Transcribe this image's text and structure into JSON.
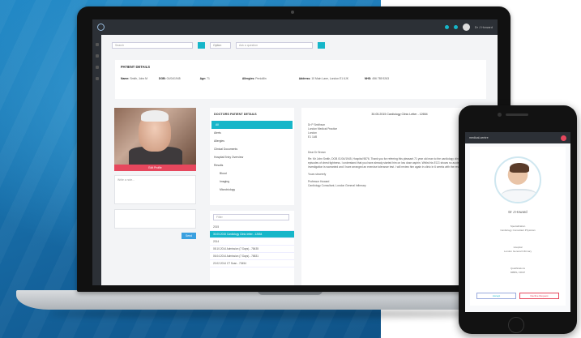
{
  "laptop": {
    "topbar": {
      "user": "Dr J Howard"
    },
    "search": {
      "placeholder": "Search",
      "select": "Option",
      "second_placeholder": "Ask a question"
    },
    "patient_details": {
      "title": "PATIENT DETAILS",
      "fields": [
        {
          "label": "Name:",
          "value": "Smith, John M"
        },
        {
          "label": "DOB:",
          "value": "01/04/1945"
        },
        {
          "label": "Age:",
          "value": "71"
        },
        {
          "label": "Allergies:",
          "value": "Penicillin"
        },
        {
          "label": "Address:",
          "value": "10 Main Lane, London E1 6JK"
        },
        {
          "label": "NHS:",
          "value": "456 785 9263"
        }
      ]
    },
    "photo_button": "Edit Profile",
    "note_placeholder": "Write a note...",
    "send_label": "Send",
    "menu": {
      "title": "DOCTORS PATIENT DETAILS",
      "items": [
        {
          "label": "All",
          "active": true,
          "sub": false
        },
        {
          "label": "Alerts",
          "active": false,
          "sub": false
        },
        {
          "label": "Allergies",
          "active": false,
          "sub": false
        },
        {
          "label": "Clinical Documents",
          "active": false,
          "sub": false
        },
        {
          "label": "Hospital Entry Overview",
          "active": false,
          "sub": false
        },
        {
          "label": "Results",
          "active": false,
          "sub": false
        },
        {
          "label": "Blood",
          "active": false,
          "sub": true
        },
        {
          "label": "Imaging",
          "active": false,
          "sub": true
        },
        {
          "label": "Microbiology",
          "active": false,
          "sub": true
        }
      ]
    },
    "list": {
      "filter_placeholder": "Filter",
      "items": [
        {
          "label": "2015",
          "hl": false
        },
        {
          "label": "30.05.2015 Cardiology Clinic letter - 12654",
          "hl": true
        },
        {
          "label": "2014",
          "hl": false
        },
        {
          "label": "08.10.2014 Admission (7 Days) - 78435",
          "hl": false
        },
        {
          "label": "06.04.2014 Admission (7 Days) - 76831",
          "hl": false
        },
        {
          "label": "20.02.2014 CT Scan - 73454",
          "hl": false
        }
      ]
    },
    "letter": {
      "title": "30.05.2015 Cardiology Clinic Letter - 12654",
      "address": [
        "Dr P Smithson",
        "London Medical Practice",
        "London",
        "E1 1AB"
      ],
      "salutation": "Dear Dr Brown",
      "body": "Re: Mr John Smith, DOB 01/04/1945, Hospital 9876. Thank you for referring this pleasant 71 year old man to the cardiology clinic with regards to his episodes of chest tightness. I understand that you have already started him on low dose aspirin. Whilst his ECG shows no acute changes, further investigation is warranted and I have arranged an exercise tolerance test. I will review him again in clinic in 6 weeks with the results.",
      "sign_off": "Yours sincerely",
      "signature": "Professor Howard",
      "signature_role": "Cardiology Consultant, London General Infirmary"
    }
  },
  "phone": {
    "brand": "medical-centre",
    "doctor_name": "Dr J Howard",
    "info": [
      [
        "Specialization",
        "Cardiology Consultant Physician"
      ],
      [
        "Hospital",
        "London General Infirmary"
      ],
      [
        "Qualifications",
        "MBBS, FRCP"
      ]
    ],
    "buttons": {
      "accept": "Accept",
      "decline": "Decline Request"
    }
  }
}
